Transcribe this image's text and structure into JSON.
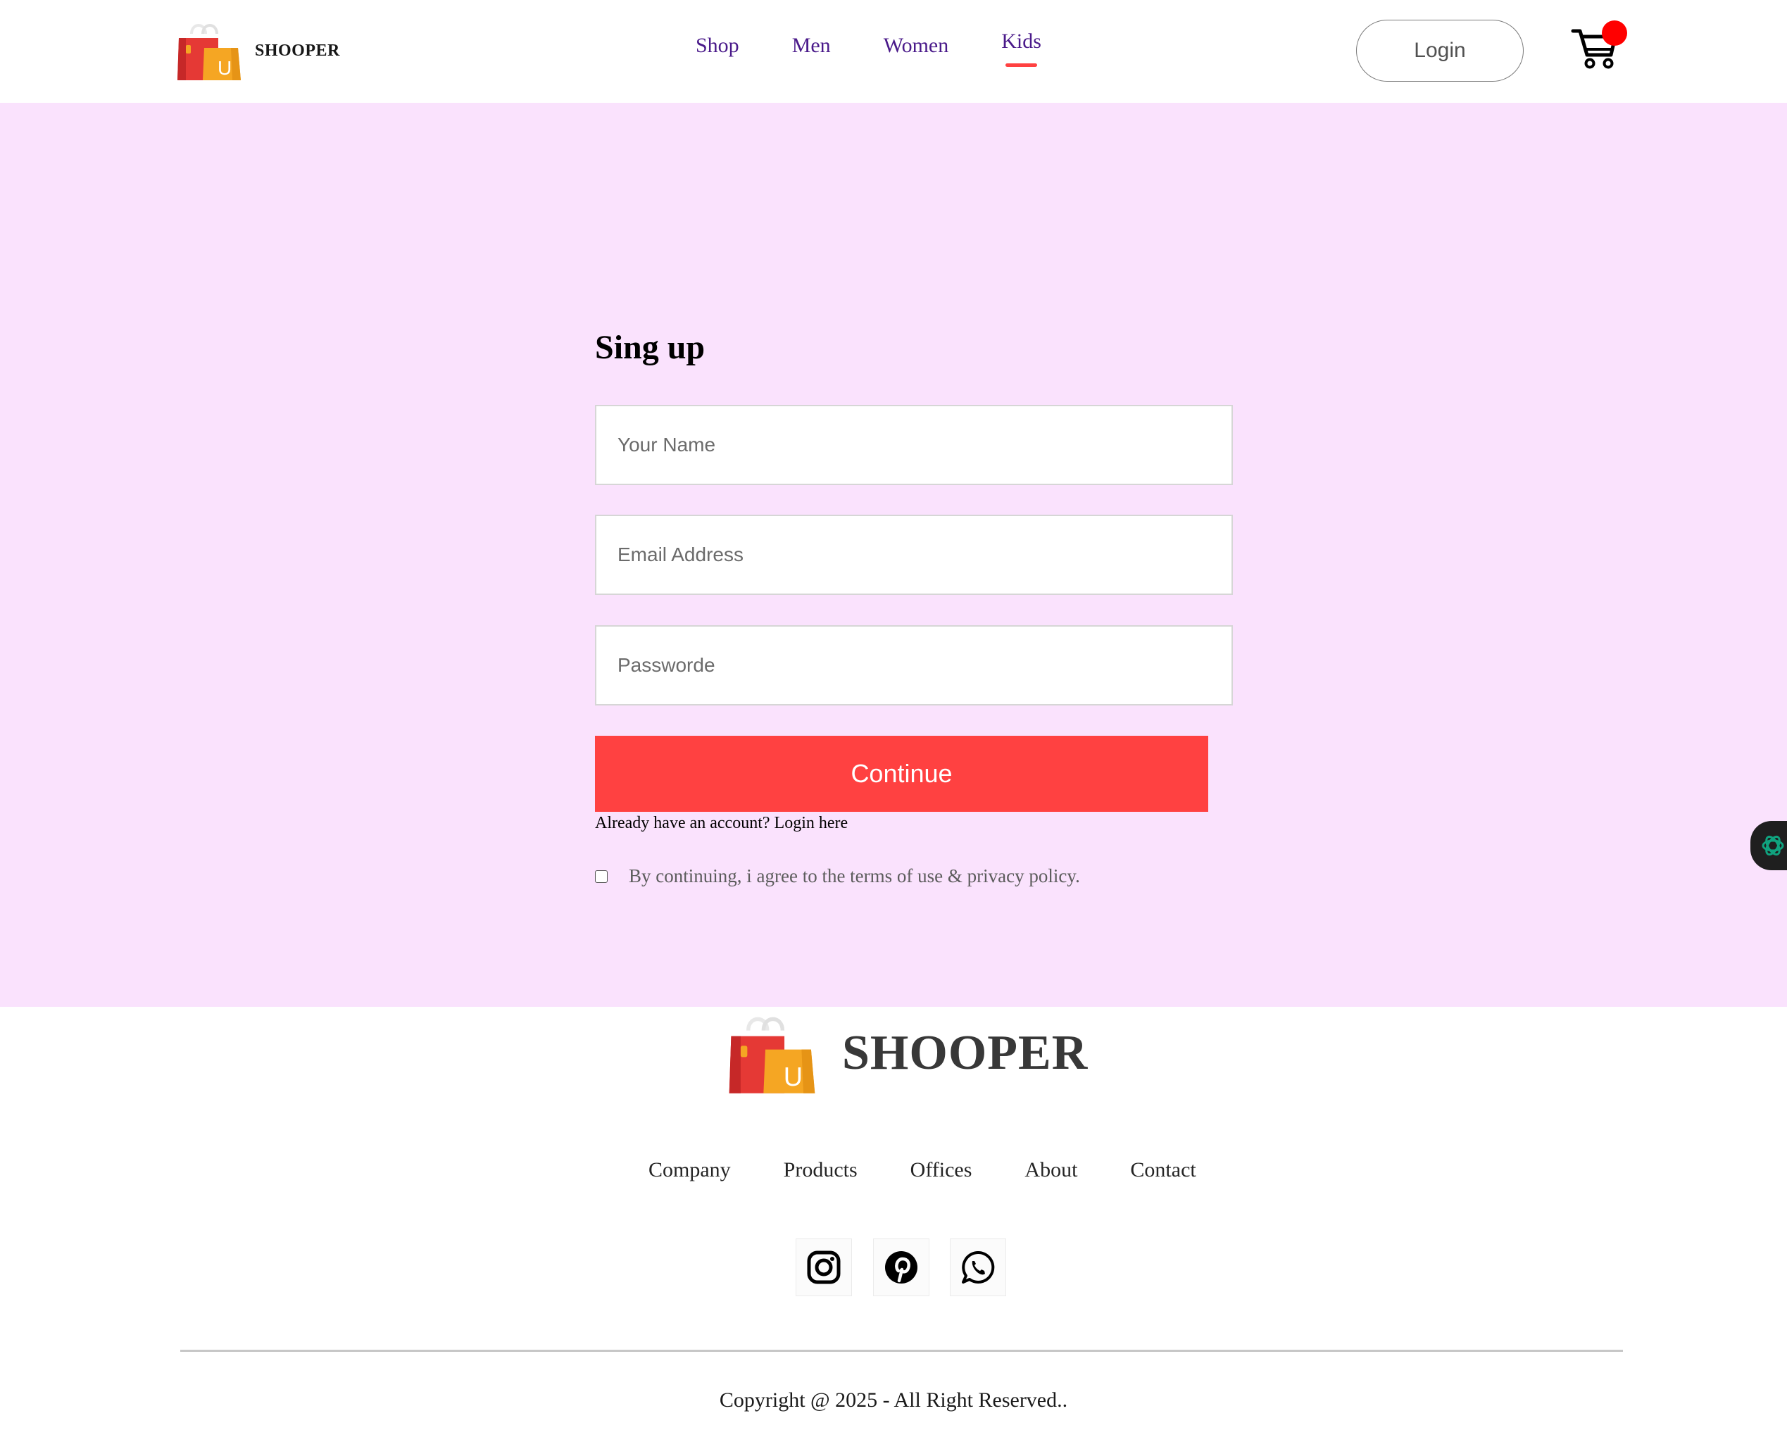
{
  "navbar": {
    "brand": "SHOOPER",
    "menu": [
      {
        "label": "Shop"
      },
      {
        "label": "Men"
      },
      {
        "label": "Women"
      },
      {
        "label": "Kids"
      }
    ],
    "active_item": "Kids",
    "login_label": "Login",
    "cart_icon": "cart-icon",
    "cart_badge_color": "#ff0000"
  },
  "signup": {
    "title": "Sing up",
    "name_placeholder": "Your Name",
    "email_placeholder": "Email Address",
    "password_placeholder": "Passworde",
    "continue_label": "Continue",
    "already_text": "Already have an account?",
    "login_here": "Login here",
    "agree_text": "By continuing, i agree to the terms of use & privacy policy.",
    "agree_checked": false
  },
  "footer": {
    "brand": "SHOOPER",
    "links": [
      {
        "label": "Company"
      },
      {
        "label": "Products"
      },
      {
        "label": "Offices"
      },
      {
        "label": "About"
      },
      {
        "label": "Contact"
      }
    ],
    "social": [
      "instagram-icon",
      "pinterest-icon",
      "whatsapp-icon"
    ],
    "copyright": "Copyright @ 2025 - All Right Reserved.."
  },
  "colors": {
    "accent": "#ff4141",
    "page_background": "#fae2fd",
    "nav_text": "#4a1a8a"
  }
}
